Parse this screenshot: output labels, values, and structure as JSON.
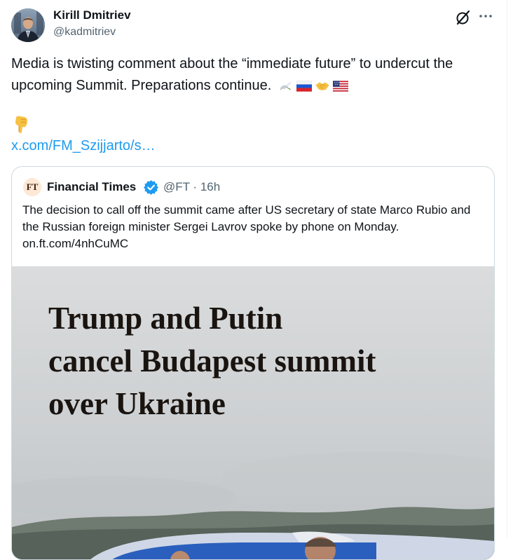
{
  "tweet": {
    "author_name": "Kirill Dmitriev",
    "author_handle": "@kadmitriev",
    "text": "Media is twisting comment about the “immediate future” to undercut the upcoming Summit. Preparations continue.",
    "emojis": [
      "dove-icon",
      "russia-flag-icon",
      "handshake-icon",
      "usa-flag-icon"
    ],
    "pointing_emoji": "pointing-down-icon",
    "link": "x.com/FM_Szijjarto/s…"
  },
  "quote": {
    "logo_text": "FT",
    "name": "Financial Times",
    "handle": "@FT",
    "time": "· 16h",
    "text": "The decision to call off the summit came after US secretary of state Marco Rubio and the Russian foreign minister Sergei Lavrov spoke by phone on Monday. on.ft.com/4nhCuMC",
    "media_headline": [
      "Trump and Putin",
      "cancel Budapest summit",
      "over Ukraine"
    ]
  },
  "colors": {
    "link": "#1d9bf0",
    "secondary_text": "#536471",
    "border": "#cfd9de",
    "verified": "#1d9bf0"
  }
}
